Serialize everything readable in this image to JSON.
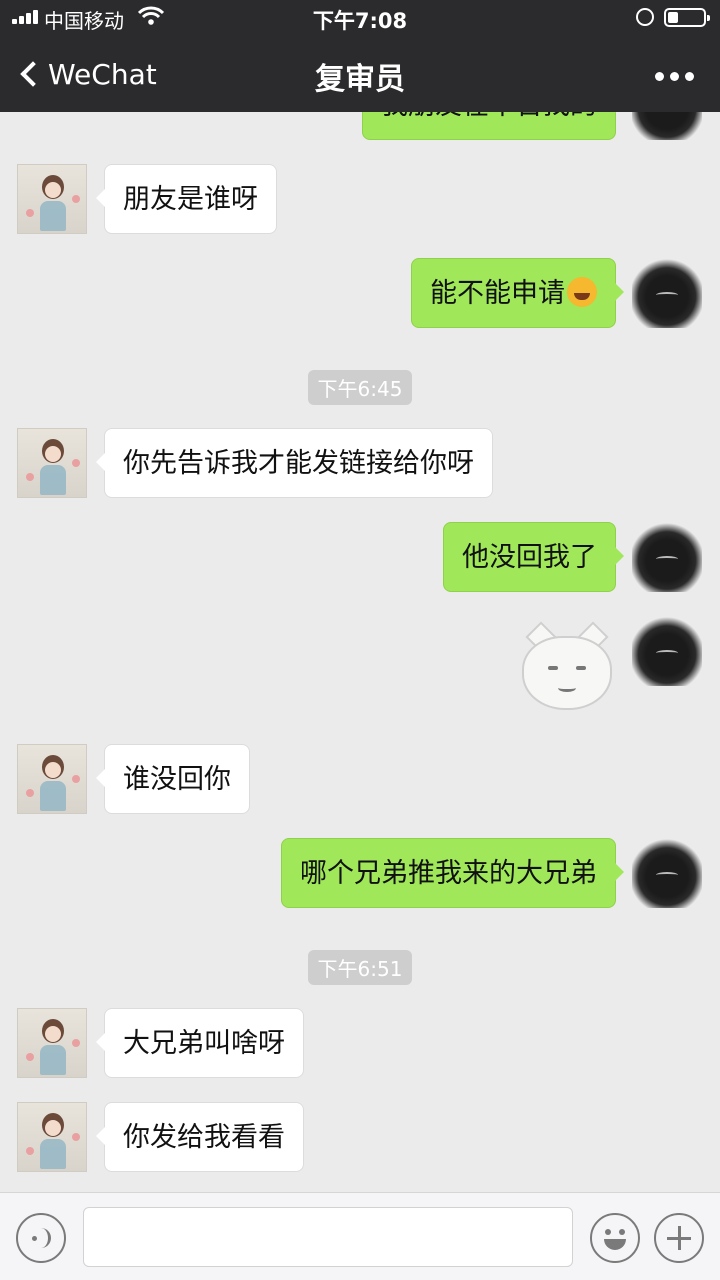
{
  "status_bar": {
    "carrier": "中国移动",
    "time": "下午7:08"
  },
  "nav": {
    "back_label": "WeChat",
    "title": "复审员"
  },
  "messages": [
    {
      "side": "out",
      "text": "我朋友在平台找的"
    },
    {
      "side": "in",
      "text": "朋友是谁呀"
    },
    {
      "side": "out",
      "text": "能不能申请",
      "emoji": "laughing-crying-emoji"
    },
    {
      "type": "time",
      "text": "下午6:45"
    },
    {
      "side": "in",
      "text": "你先告诉我才能发链接给你呀"
    },
    {
      "side": "out",
      "text": "他没回我了"
    },
    {
      "side": "out",
      "type": "sticker",
      "sticker": "pouting-baby-face-sticker"
    },
    {
      "side": "in",
      "text": "谁没回你"
    },
    {
      "side": "out",
      "text": "哪个兄弟推我来的大兄弟"
    },
    {
      "type": "time",
      "text": "下午6:51"
    },
    {
      "side": "in",
      "text": "大兄弟叫啥呀"
    },
    {
      "side": "in",
      "text": "你发给我看看"
    }
  ],
  "colors": {
    "outgoing_bubble": "#a0e75a",
    "incoming_bubble": "#ffffff",
    "background": "#ebebeb",
    "nav_bg": "#2b2b2d"
  }
}
